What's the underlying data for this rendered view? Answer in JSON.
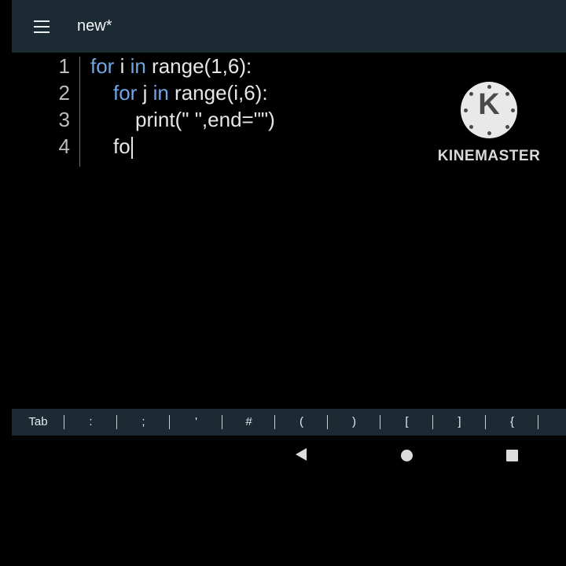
{
  "toolbar": {
    "title": "new*",
    "menu_icon": "hamburger-menu-icon"
  },
  "editor": {
    "lines": [
      {
        "number": "1",
        "tokens": [
          {
            "t": "for",
            "kw": true
          },
          {
            "t": " i "
          },
          {
            "t": "in",
            "kw": true
          },
          {
            "t": " range(1,6):"
          }
        ]
      },
      {
        "number": "2",
        "tokens": [
          {
            "t": "for",
            "kw": true
          },
          {
            "t": " j "
          },
          {
            "t": "in",
            "kw": true
          },
          {
            "t": " range(i,6):"
          }
        ]
      },
      {
        "number": "3",
        "tokens": [
          {
            "t": "print(\" \",end=\"\")"
          }
        ]
      },
      {
        "number": "4",
        "tokens": [
          {
            "t": "fo"
          }
        ]
      }
    ],
    "keyword_color": "#6fa6e6"
  },
  "watermark": {
    "logo_letter": "K",
    "text": "KINEMASTER"
  },
  "keybar": {
    "keys": [
      "Tab",
      ":",
      ";",
      "'",
      "#",
      "(",
      ")",
      "[",
      "]",
      "{"
    ]
  },
  "navbar": {
    "back": "back-triangle-icon",
    "home": "home-circle-icon",
    "recents": "recents-square-icon"
  }
}
